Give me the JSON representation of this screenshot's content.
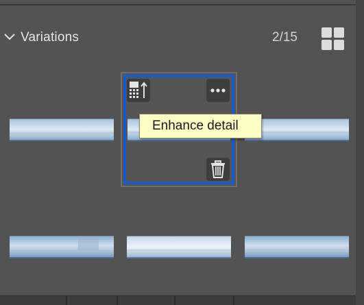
{
  "panel": {
    "title": "Variations",
    "counter": "2/15",
    "collapse_icon": "chevron-down-icon",
    "view_toggle_icon": "grid-view-icon"
  },
  "selected_variation": {
    "index": 2,
    "tooltip": "Enhance detail",
    "icons": [
      "enhance-detail-icon",
      "more-options-icon",
      "trash-icon"
    ]
  },
  "colors": {
    "panel_bg": "#535353",
    "selection_border": "#1a5bc8",
    "tooltip_bg": "#fdfcc7",
    "text": "#e6e6e6"
  }
}
